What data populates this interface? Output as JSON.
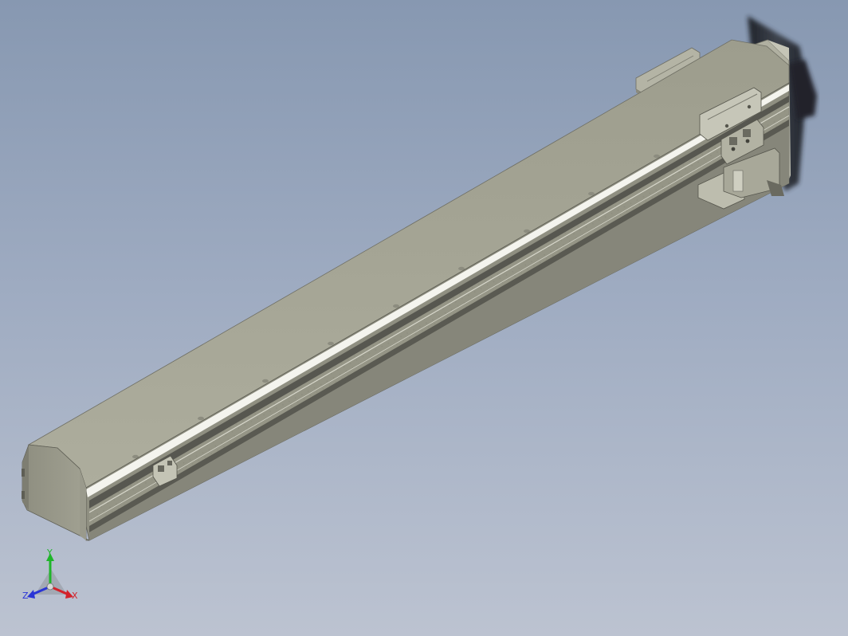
{
  "viewport": {
    "background_top": "#8798b1",
    "background_bottom": "#bcc3d1"
  },
  "model": {
    "body_color": "#a7a797",
    "top_color": "#a3a393",
    "slot_color": "#4f4f47",
    "edge_color": "#f4f4ee",
    "motor_color": "#2a2e35"
  },
  "triad": {
    "x_label": "X",
    "y_label": "Y",
    "z_label": "Z",
    "x_color": "#d3222b",
    "y_color": "#1fb52a",
    "z_color": "#2a35d6"
  }
}
